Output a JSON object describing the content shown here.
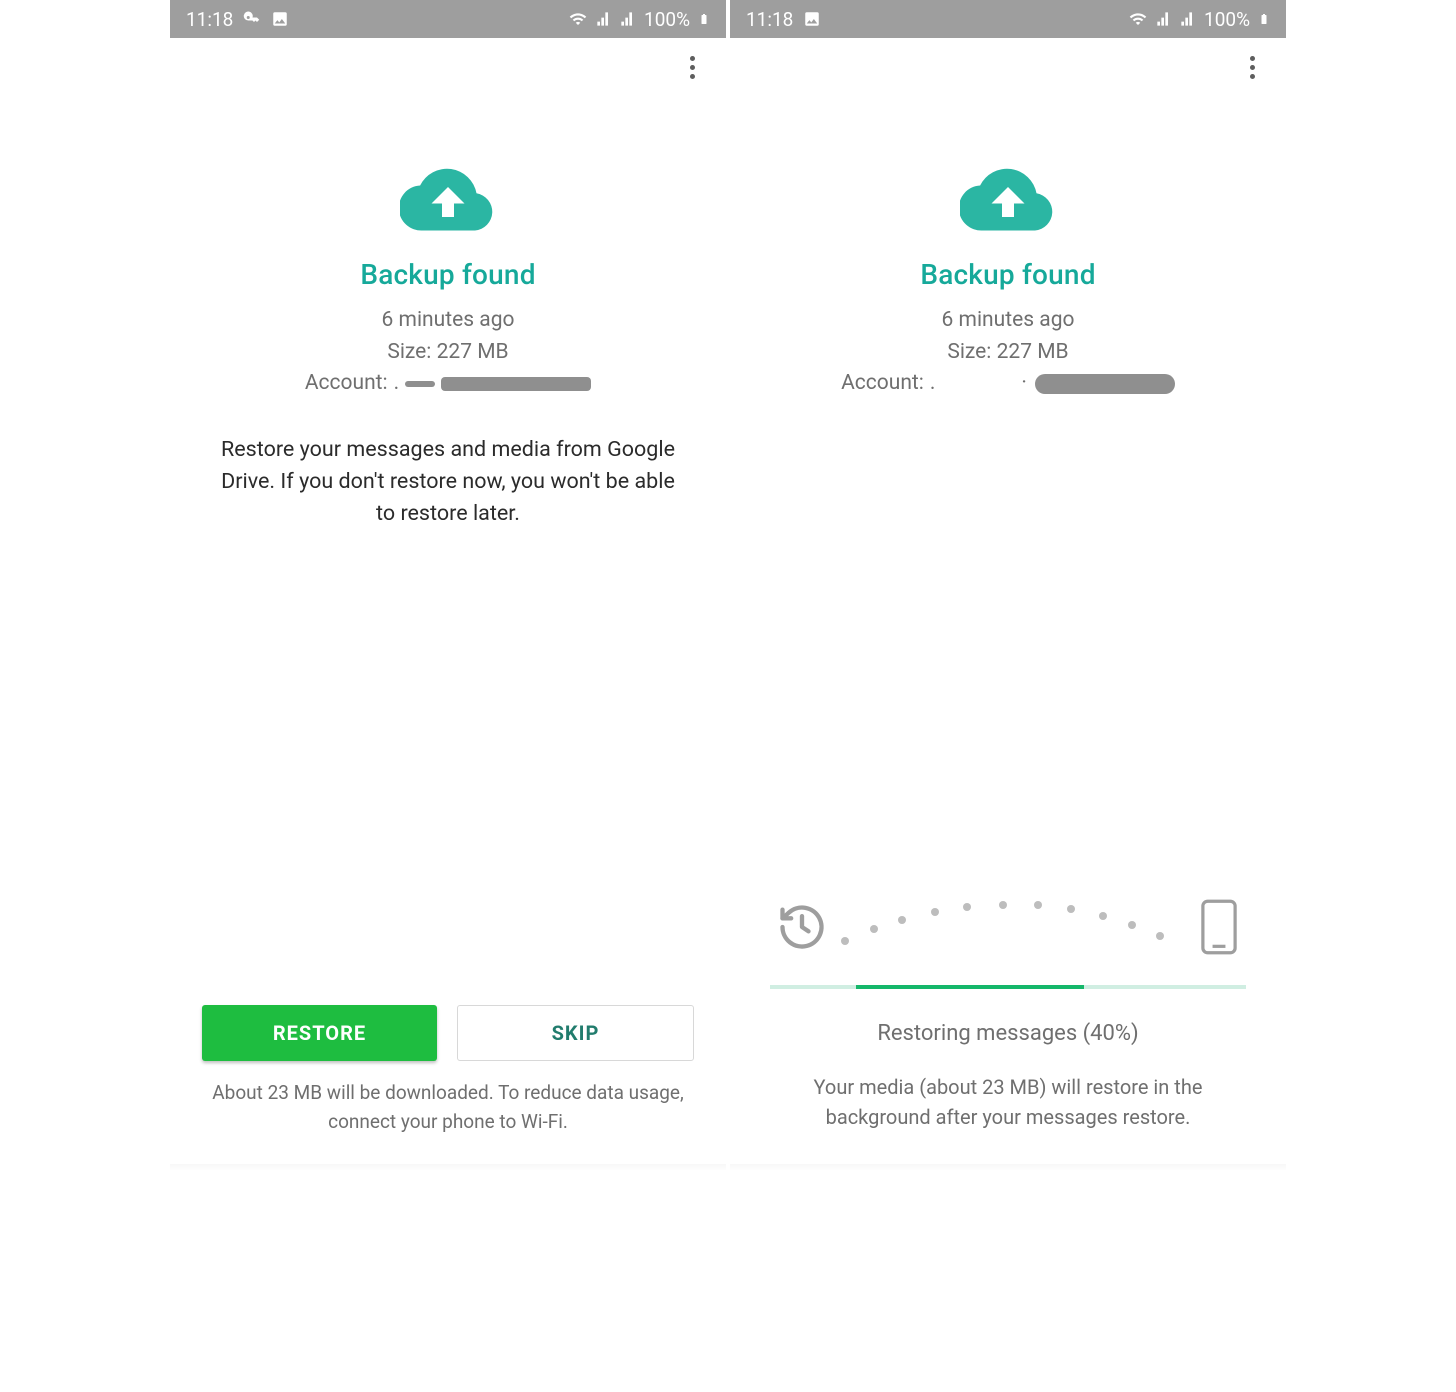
{
  "status": {
    "time": "11:18",
    "battery": "100%"
  },
  "actionbar": {
    "overflow": "more"
  },
  "common": {
    "title": "Backup found",
    "time_ago": "6 minutes ago",
    "size": "Size: 227 MB",
    "account_label": "Account:"
  },
  "left": {
    "description": "Restore your messages and media from Google Drive. If you don't restore now, you won't be able to restore later.",
    "restore_btn": "RESTORE",
    "skip_btn": "SKIP",
    "footer": "About 23 MB will be downloaded. To reduce data usage, connect your phone to Wi-Fi."
  },
  "right": {
    "progress_percent": 40,
    "progress_label": "Restoring messages (40%)",
    "media_note": "Your media (about 23 MB) will restore in the background after your messages restore."
  },
  "colors": {
    "brand": "#16a99a",
    "primary_btn": "#1ebd40",
    "progress": "#15b76a"
  }
}
